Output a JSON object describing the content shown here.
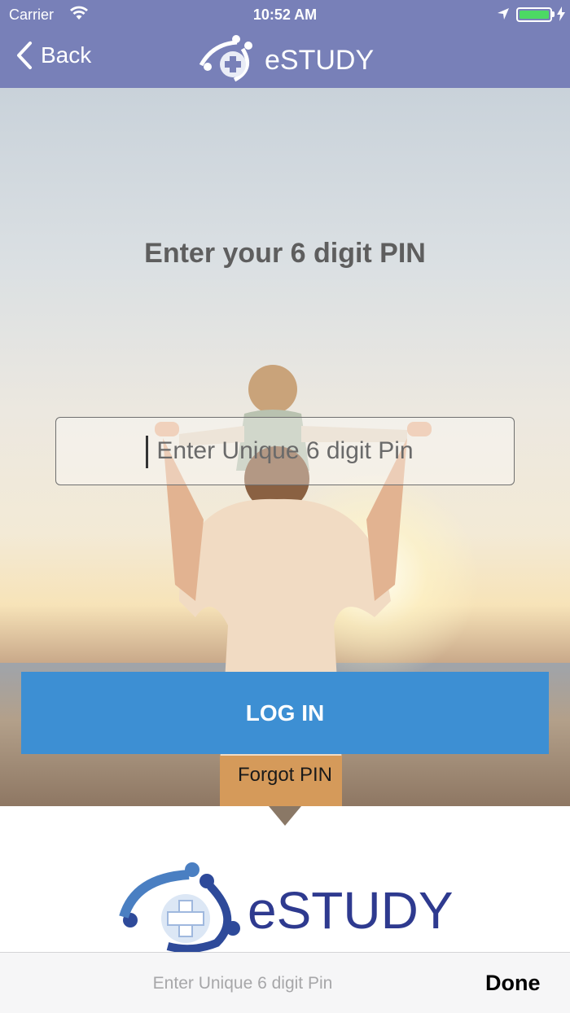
{
  "status_bar": {
    "carrier": "Carrier",
    "time": "10:52 AM",
    "battery_level": 1.0,
    "battery_color": "#4cd964"
  },
  "nav": {
    "back_label": "Back",
    "logo_text": "eSTUDY",
    "background": "#7880b8"
  },
  "main": {
    "title": "Enter your 6 digit PIN",
    "pin_input": {
      "value": "",
      "placeholder": "Enter Unique 6 digit Pin"
    },
    "login_label": "LOG IN",
    "login_color": "#3d8fd3",
    "forgot_label": "Forgot PIN"
  },
  "footer": {
    "logo_text": "eSTUDY"
  },
  "keyboard_accessory": {
    "hint": "Enter Unique 6 digit Pin",
    "done_label": "Done"
  },
  "icons": [
    "wifi-icon",
    "location-arrow-icon",
    "battery-icon",
    "charging-bolt-icon",
    "chevron-left-icon",
    "estudy-logo"
  ]
}
